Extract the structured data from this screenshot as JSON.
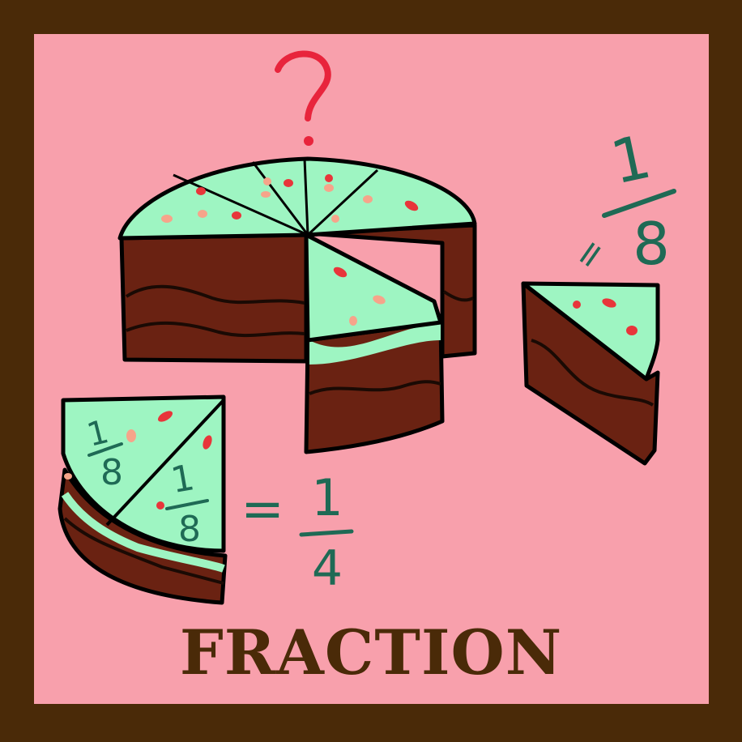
{
  "title": "FRACTION",
  "question_mark": "?",
  "slice_label": {
    "numerator": "1",
    "denominator": "8",
    "equals": "="
  },
  "quarter_pieces": {
    "piece_a": {
      "numerator": "1",
      "denominator": "8"
    },
    "piece_b": {
      "numerator": "1",
      "denominator": "8"
    }
  },
  "quarter_result": {
    "equals": "=",
    "numerator": "1",
    "denominator": "4"
  },
  "colors": {
    "frame": "#4a2a08",
    "background": "#f8a0ac",
    "frosting": "#9ef5c2",
    "cake": "#6a2212",
    "sprinkle_red": "#e8353a",
    "sprinkle_pink": "#f6a48a",
    "handwriting": "#1f6a55",
    "question_mark": "#e8243c"
  }
}
